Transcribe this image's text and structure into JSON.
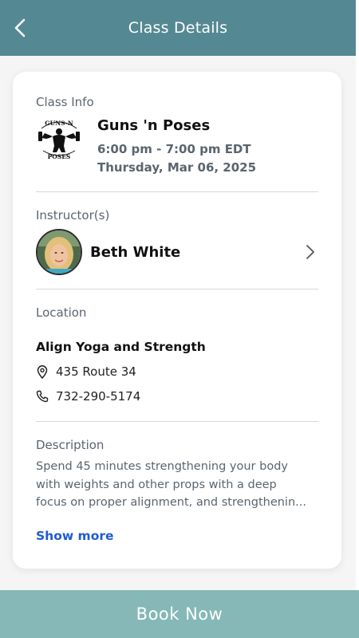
{
  "header": {
    "title": "Class Details",
    "back_icon": "chevron-left-icon"
  },
  "class_info": {
    "section_label": "Class Info",
    "logo_name": "guns-n-poses-logo",
    "logo_text_top": "GUNS-N",
    "logo_text_bottom": "POSES",
    "name": "Guns 'n Poses",
    "time": "6:00 pm - 7:00 pm EDT",
    "date": "Thursday, Mar 06, 2025"
  },
  "instructors": {
    "section_label": "Instructor(s)",
    "items": [
      {
        "name": "Beth White",
        "icon": "chevron-right-icon"
      }
    ]
  },
  "location": {
    "section_label": "Location",
    "name": "Align Yoga and Strength",
    "address": "435 Route 34",
    "address_icon": "map-pin-icon",
    "phone": "732-290-5174",
    "phone_icon": "phone-icon"
  },
  "description": {
    "section_label": "Description",
    "lines": [
      "Spend 45 minutes strengthening your body",
      "with weights and other props with a deep",
      "focus on proper alignment, and strengthenin..."
    ],
    "show_more_label": "Show more"
  },
  "footer": {
    "book_label": "Book Now"
  },
  "colors": {
    "header_bg": "#548993",
    "book_bg": "#85b8b6",
    "link": "#1e5bd6"
  }
}
